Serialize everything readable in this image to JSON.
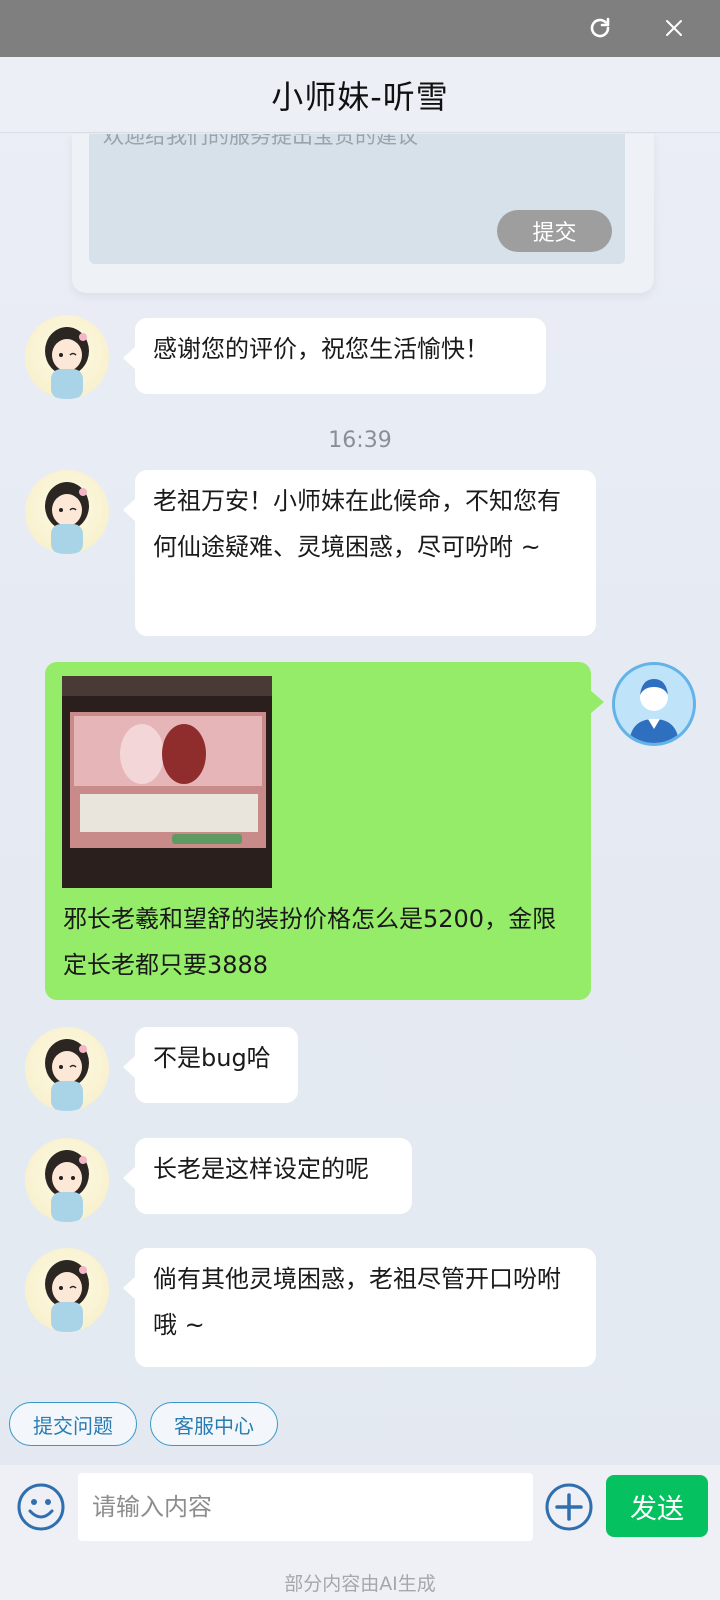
{
  "app": {
    "title": "小师妹-听雪"
  },
  "topbar": {
    "refresh_icon": "refresh-icon",
    "close_icon": "close-icon"
  },
  "feedback": {
    "placeholder": "欢迎给我们的服务提出宝贵的建议",
    "submit_label": "提交"
  },
  "messages": {
    "m1": "感谢您的评价，祝您生活愉快！",
    "time": "16:39",
    "m2": "老祖万安！小师妹在此候命，不知您有何仙途疑难、灵境困惑，尽可吩咐 ~",
    "user_text": "邪长老羲和望舒的装扮价格怎么是5200，金限定长老都只要3888",
    "m3": "不是bug哈",
    "m4": "长老是这样设定的呢",
    "m5": "倘有其他灵境困惑，老祖尽管开口吩咐哦 ~"
  },
  "quick_actions": [
    "提交问题",
    "客服中心"
  ],
  "composer": {
    "placeholder": "请输入内容",
    "send_label": "发送",
    "emoji_icon": "emoji-icon",
    "plus_icon": "plus-circle-icon"
  },
  "footer_note": "部分内容由AI生成",
  "colors": {
    "user_bubble": "#95ec69",
    "send_button": "#06c160",
    "chip_border": "#3b97c9"
  }
}
